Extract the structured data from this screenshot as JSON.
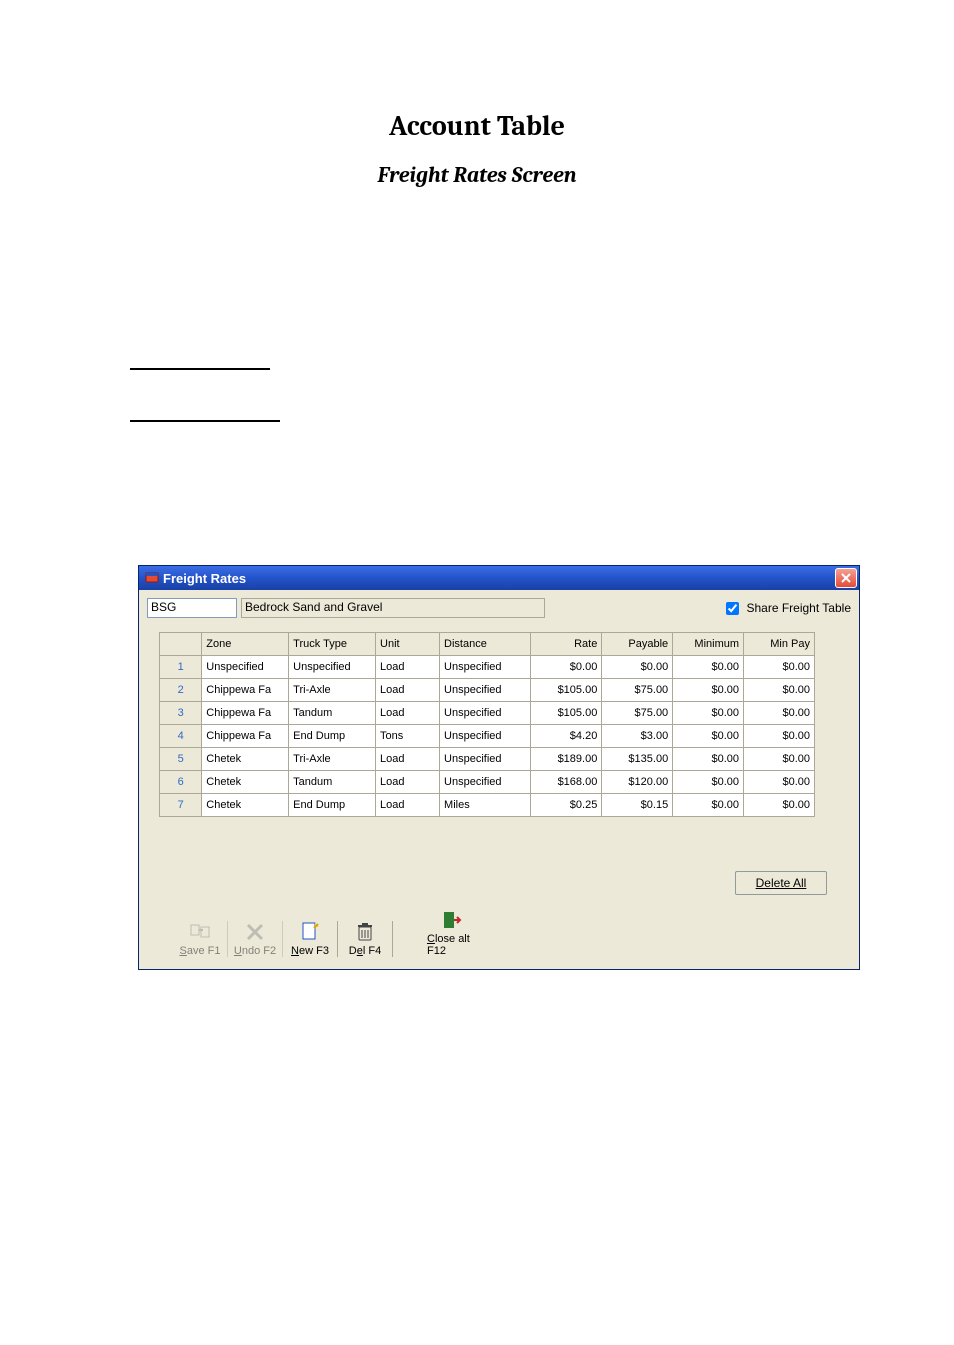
{
  "doc": {
    "title": "Account Table",
    "subtitle": "Freight Rates Screen"
  },
  "window": {
    "title": "Freight Rates",
    "code": "BSG",
    "name": "Bedrock Sand and Gravel",
    "share_label": "Share Freight Table",
    "share_checked": true,
    "delete_all": "Delete All",
    "delete_all_u": "l",
    "columns": [
      "Zone",
      "Truck Type",
      "Unit",
      "Distance",
      "Rate",
      "Payable",
      "Minimum",
      "Min Pay"
    ],
    "rows": [
      {
        "n": "1",
        "zone": "Unspecified",
        "truck": "Unspecified",
        "unit": "Load",
        "dist": "Unspecified",
        "rate": "$0.00",
        "pay": "$0.00",
        "min": "$0.00",
        "mpay": "$0.00"
      },
      {
        "n": "2",
        "zone": "Chippewa Fa",
        "truck": "Tri-Axle",
        "unit": "Load",
        "dist": "Unspecified",
        "rate": "$105.00",
        "pay": "$75.00",
        "min": "$0.00",
        "mpay": "$0.00"
      },
      {
        "n": "3",
        "zone": "Chippewa Fa",
        "truck": "Tandum",
        "unit": "Load",
        "dist": "Unspecified",
        "rate": "$105.00",
        "pay": "$75.00",
        "min": "$0.00",
        "mpay": "$0.00"
      },
      {
        "n": "4",
        "zone": "Chippewa Fa",
        "truck": "End Dump",
        "unit": "Tons",
        "dist": "Unspecified",
        "rate": "$4.20",
        "pay": "$3.00",
        "min": "$0.00",
        "mpay": "$0.00"
      },
      {
        "n": "5",
        "zone": "Chetek",
        "truck": "Tri-Axle",
        "unit": "Load",
        "dist": "Unspecified",
        "rate": "$189.00",
        "pay": "$135.00",
        "min": "$0.00",
        "mpay": "$0.00"
      },
      {
        "n": "6",
        "zone": "Chetek",
        "truck": "Tandum",
        "unit": "Load",
        "dist": "Unspecified",
        "rate": "$168.00",
        "pay": "$120.00",
        "min": "$0.00",
        "mpay": "$0.00"
      },
      {
        "n": "7",
        "zone": "Chetek",
        "truck": "End Dump",
        "unit": "Load",
        "dist": "Miles",
        "rate": "$0.25",
        "pay": "$0.15",
        "min": "$0.00",
        "mpay": "$0.00"
      }
    ],
    "toolbar": {
      "save": {
        "pre": "",
        "u": "S",
        "post": "ave F1"
      },
      "undo": {
        "pre": "",
        "u": "U",
        "post": "ndo F2"
      },
      "new": {
        "pre": "",
        "u": "N",
        "post": "ew F3"
      },
      "del": {
        "pre": "D",
        "u": "e",
        "post": "l F4"
      },
      "close": {
        "pre": "",
        "u": "C",
        "post": "lose alt F12"
      }
    }
  }
}
